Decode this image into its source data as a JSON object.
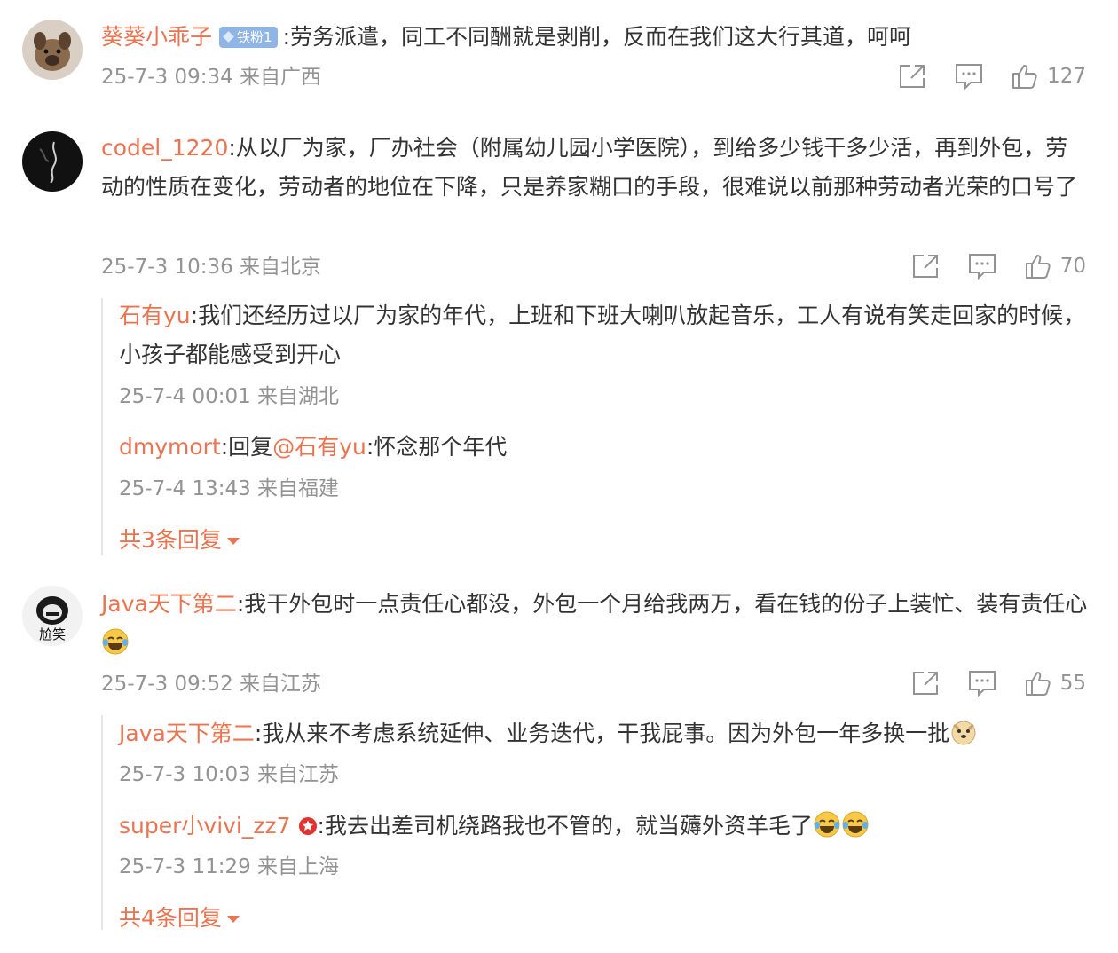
{
  "comments": [
    {
      "author": "葵葵小乖子",
      "badge": "铁粉1",
      "text": ":劳务派遣，同工不同酬就是剥削，反而在我们这大行其道，呵呵",
      "time": "25-7-3 09:34 来自广西",
      "likes": "127"
    },
    {
      "author": "codel_1220",
      "text": ":从以厂为家，厂办社会（附属幼儿园小学医院），到给多少钱干多少活，再到外包，劳动的性质在变化，劳动者的地位在下降，只是养家糊口的手段，很难说以前那种劳动者光荣的口号了",
      "time": "25-7-3 10:36 来自北京",
      "likes": "70",
      "replies": [
        {
          "author": "石有yu",
          "text": ":我们还经历过以厂为家的年代，上班和下班大喇叭放起音乐，工人有说有笑走回家的时候，小孩子都能感受到开心",
          "time": "25-7-4 00:01 来自湖北"
        },
        {
          "author": "dmymort",
          "prefix": ":回复",
          "mention": "@石有yu",
          "text": ":怀念那个年代",
          "time": "25-7-4 13:43 来自福建"
        }
      ],
      "more_label": "共3条回复"
    },
    {
      "author": "Java天下第二",
      "avatar_text": "尬笑",
      "text": ":我干外包时一点责任心都没，外包一个月给我两万，看在钱的份子上装忙、装有责任心",
      "time": "25-7-3 09:52 来自江苏",
      "likes": "55",
      "replies": [
        {
          "author": "Java天下第二",
          "text": ":我从来不考虑系统延伸、业务迭代，干我屁事。因为外包一年多换一批",
          "time": "25-7-3 10:03 来自江苏"
        },
        {
          "author": "super小vivi_zz7",
          "text": ":我去出差司机绕路我也不管的，就当薅外资羊毛了",
          "time": "25-7-3 11:29 来自上海"
        }
      ],
      "more_label": "共4条回复"
    }
  ],
  "icons": {
    "share": "share-icon",
    "comment": "comment-icon",
    "like": "thumbs-up-icon"
  },
  "colors": {
    "author": "#eb7350",
    "meta": "#939393",
    "text": "#333333"
  }
}
